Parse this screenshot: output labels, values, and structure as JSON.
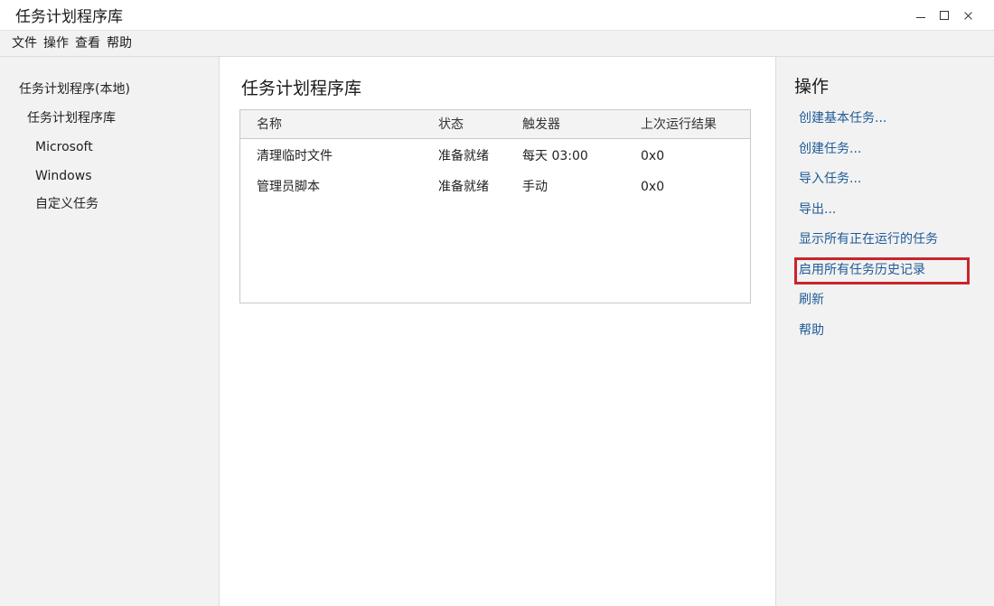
{
  "window": {
    "title": "任务计划程序库"
  },
  "menubar": {
    "items": [
      "文件",
      "操作",
      "查看",
      "帮助"
    ]
  },
  "nav": {
    "items": [
      "任务计划程序(本地)",
      "任务计划程序库",
      "Microsoft",
      "Windows",
      "自定义任务"
    ]
  },
  "main": {
    "title": "任务计划程序库",
    "columns": [
      "名称",
      "状态",
      "触发器",
      "上次运行结果"
    ],
    "rows": [
      [
        "清理临时文件",
        "准备就绪",
        "每天 03:00",
        "0x0"
      ],
      [
        "管理员脚本",
        "准备就绪",
        "手动",
        "0x0"
      ]
    ]
  },
  "actions": {
    "title": "操作",
    "items": [
      "创建基本任务...",
      "创建任务...",
      "导入任务...",
      "导出...",
      "显示所有正在运行的任务",
      "启用所有任务历史记录",
      "刷新",
      "帮助"
    ],
    "highlight_color": "#c8252b",
    "link_color": "#1f5a96"
  }
}
